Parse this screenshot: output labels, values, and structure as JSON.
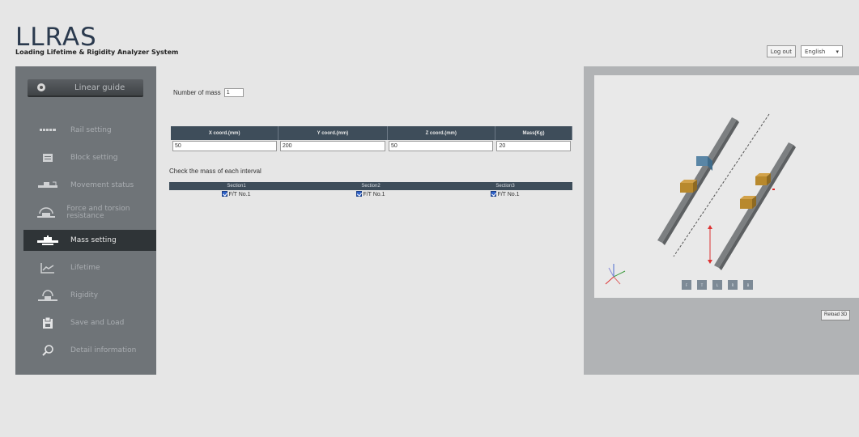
{
  "header": {
    "app_title": "LLRAS",
    "app_subtitle": "Loading Lifetime & Rigidity Analyzer System",
    "logout_label": "Log out",
    "language_selected": "English",
    "language_arrow": "▾"
  },
  "sidebar": {
    "guide_label": "Linear guide",
    "items": [
      {
        "label": "Rail setting",
        "icon": "rail-icon"
      },
      {
        "label": "Block setting",
        "icon": "block-icon"
      },
      {
        "label": "Movement status",
        "icon": "movement-icon"
      },
      {
        "label": "Force and torsion resistance",
        "icon": "force-icon"
      },
      {
        "label": "Mass setting",
        "icon": "mass-icon",
        "active": true
      },
      {
        "label": "Lifetime",
        "icon": "lifetime-chart-icon"
      },
      {
        "label": "Rigidity",
        "icon": "rigidity-icon"
      },
      {
        "label": "Save and Load",
        "icon": "save-icon"
      },
      {
        "label": "Detail information",
        "icon": "search-icon"
      }
    ]
  },
  "main": {
    "number_of_mass_label": "Number of mass",
    "number_of_mass_value": "1",
    "coord_table": {
      "headers": [
        "X coord.(mm)",
        "Y coord.(mm)",
        "Z coord.(mm)",
        "Mass(Kg)"
      ],
      "row": [
        "50",
        "200",
        "50",
        "20"
      ]
    },
    "check_label": "Check the mass of each interval",
    "section_table": {
      "headers": [
        "Section1",
        "Section2",
        "Section3"
      ],
      "row": [
        "F/T No.1",
        "F/T No.1",
        "F/T No.1"
      ]
    }
  },
  "viewer": {
    "view_buttons": [
      "F",
      "T",
      "L",
      "R",
      "B"
    ],
    "reload_label": "Reload 3D"
  },
  "colors": {
    "sidebar_bg": "#6f7478",
    "active_item_bg": "#2f3437",
    "table_header_bg": "#3e4d5a",
    "viewer_bg": "#b1b3b5",
    "block_orange": "#b8892d",
    "block_blue": "#5a86a6"
  }
}
